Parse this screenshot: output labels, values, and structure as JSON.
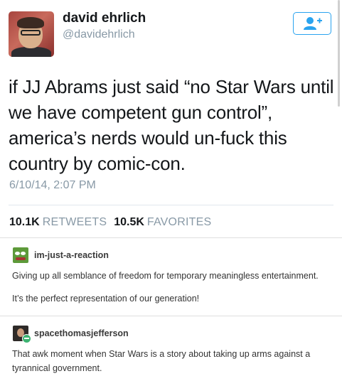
{
  "tweet": {
    "display_name": "david ehrlich",
    "handle": "@davidehrlich",
    "text": "if JJ Abrams just said “no Star Wars until we have competent gun control”, america’s nerds would un-fuck this country by comic-con.",
    "timestamp": "6/10/14, 2:07 PM",
    "stats": {
      "retweets_count": "10.1K",
      "retweets_label": "RETWEETS",
      "favorites_count": "10.5K",
      "favorites_label": "FAVORITES"
    },
    "follow_icon": "add-user-icon",
    "accent_color": "#2aa3ef"
  },
  "comments": [
    {
      "username": "im-just-a-reaction",
      "avatar_icon": "frog-avatar",
      "paragraphs": [
        "Giving up all semblance of freedom for temporary meaningless entertainment.",
        "It’s the perfect representation of our generation!"
      ]
    },
    {
      "username": "spacethomasjefferson",
      "avatar_icon": "portrait-avatar",
      "paragraphs": [
        "That awk moment when Star Wars is a story about taking up arms against a tyrannical government."
      ]
    }
  ]
}
